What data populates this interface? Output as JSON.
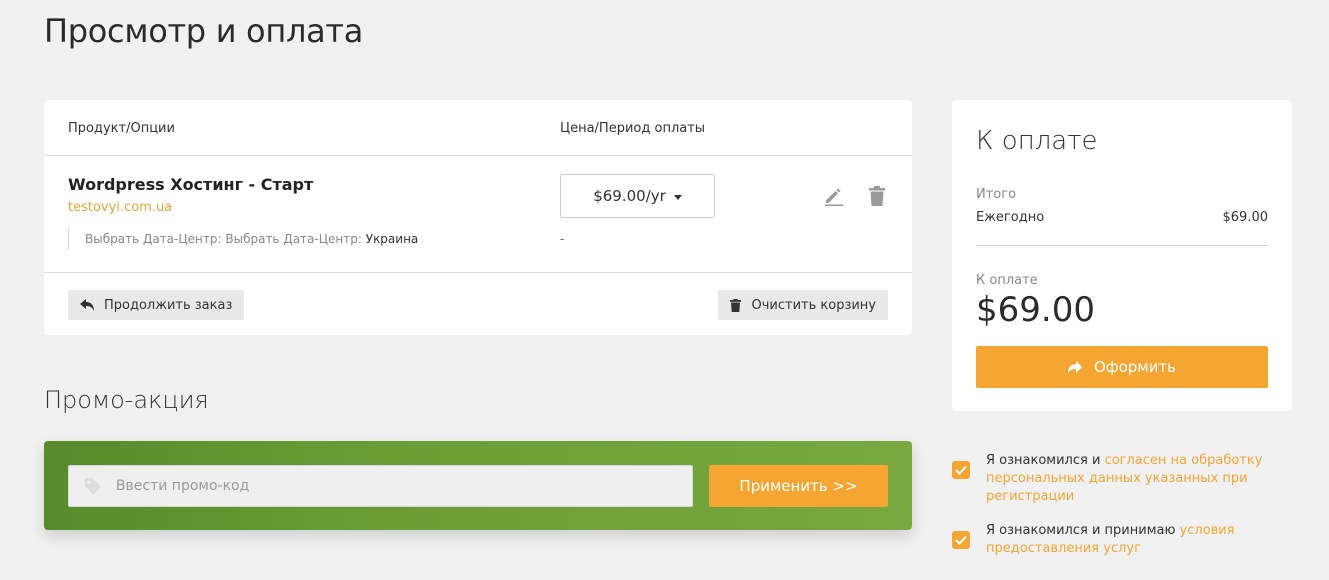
{
  "page": {
    "title": "Просмотр и оплата"
  },
  "cart": {
    "headers": {
      "product": "Продукт/Опции",
      "price": "Цена/Период оплаты"
    },
    "item": {
      "name": "Wordpress Хостинг - Старт",
      "domain": "testovyi.com.ua",
      "option_label": "Выбрать Дата-Центр: Выбрать Дата-Центр:",
      "option_value": "Украина",
      "price": "$69.00/yr",
      "option_price": "-"
    },
    "continue_label": "Продолжить заказ",
    "clear_label": "Очистить корзину"
  },
  "promo": {
    "title": "Промо-акция",
    "placeholder": "Ввести промо-код",
    "apply_label": "Применить >>"
  },
  "summary": {
    "title": "К оплате",
    "subtotal_label": "Итого",
    "period_label": "Ежегодно",
    "period_amount": "$69.00",
    "due_label": "К оплате",
    "total": "$69.00",
    "checkout_label": "Оформить"
  },
  "agreements": [
    {
      "prefix": "Я ознакомился и ",
      "link": "согласен на обработку персональных данных указанных при регистрации"
    },
    {
      "prefix": "Я ознакомился и принимаю ",
      "link": "условия предоставления услуг"
    }
  ],
  "colors": {
    "accent": "#f5a531",
    "promo_green": "#6a9e35",
    "link": "#e8a53a"
  }
}
